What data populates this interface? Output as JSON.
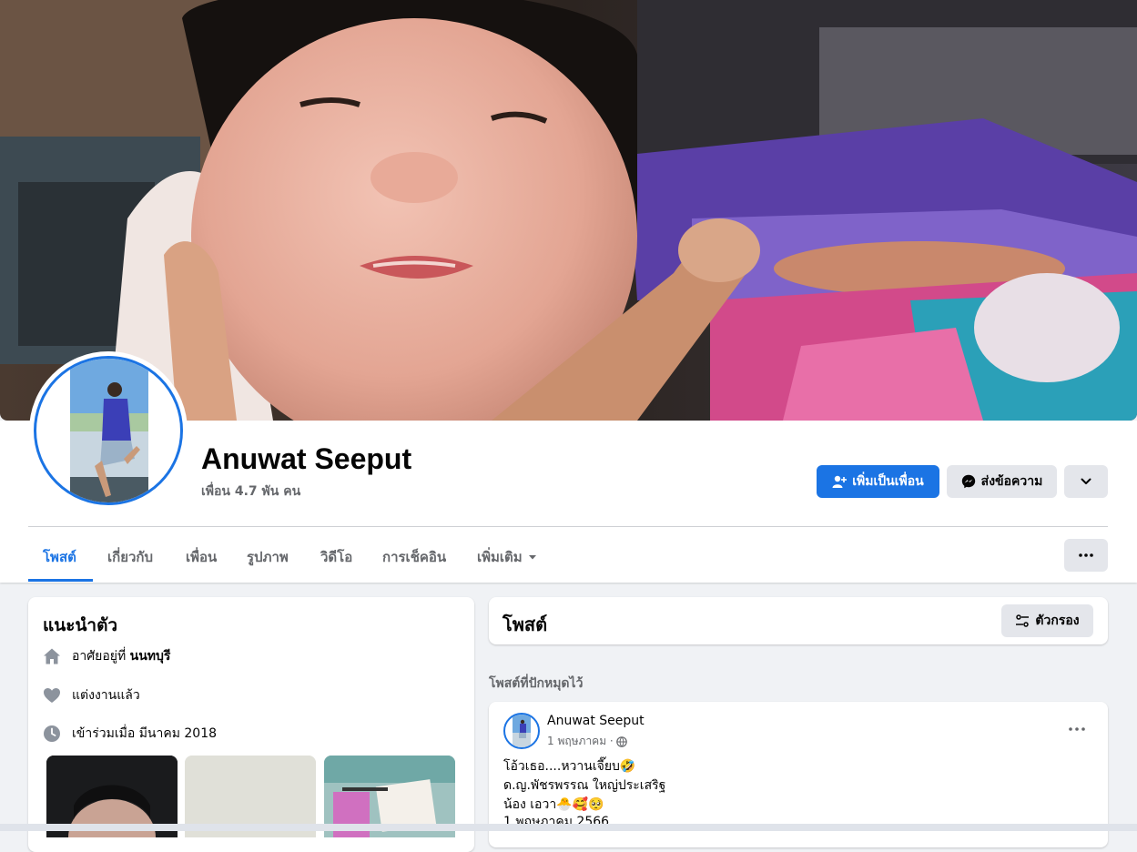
{
  "profile": {
    "name": "Anuwat Seeput",
    "friends_count": "เพื่อน 4.7 พัน คน"
  },
  "actions": {
    "add_friend": "เพิ่มเป็นเพื่อน",
    "message": "ส่งข้อความ"
  },
  "tabs": [
    {
      "label": "โพสต์",
      "active": true
    },
    {
      "label": "เกี่ยวกับ"
    },
    {
      "label": "เพื่อน"
    },
    {
      "label": "รูปภาพ"
    },
    {
      "label": "วิดีโอ"
    },
    {
      "label": "การเช็คอิน"
    },
    {
      "label": "เพิ่มเติม"
    }
  ],
  "intro": {
    "title": "แนะนำตัว",
    "lives_prefix": "อาศัยอยู่ที่",
    "lives_city": "นนทบุรี",
    "relationship": "แต่งงานแล้ว",
    "joined": "เข้าร่วมเมื่อ มีนาคม 2018"
  },
  "posts": {
    "title": "โพสต์",
    "filter_label": "ตัวกรอง",
    "pinned_label": "โพสต์ที่ปักหมุดไว้"
  },
  "post": {
    "author": "Anuwat Seeput",
    "date": "1 พฤษภาคม ·",
    "lines": [
      "โอ้วเธอ....หวานเจี๊ยบ🤣",
      "ด.ญ.พัชรพรรณ ใหญ่ประเสริฐ",
      "น้อง เอวา🐣🥰🥺",
      "1 พฤษภาคม 2566"
    ]
  },
  "colors": {
    "accent": "#1b74e4",
    "page_bg": "#f0f2f5",
    "secondary_text": "#65676b"
  }
}
